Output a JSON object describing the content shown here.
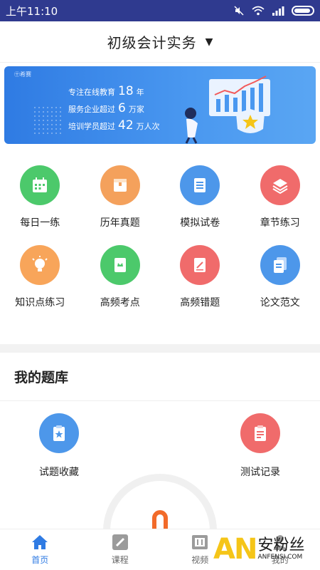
{
  "status": {
    "time": "上午11:10",
    "icons": [
      "mute-icon",
      "wifi-icon",
      "signal-icon",
      "battery-icon"
    ]
  },
  "header": {
    "title": "初级会计实务",
    "caret": "▼"
  },
  "banner": {
    "logo": "㊉希赛",
    "line1_pre": "专注在线教育",
    "line1_num": "18",
    "line1_post": "年",
    "line2_pre": "服务企业超过",
    "line2_num": "6",
    "line2_post": "万家",
    "line3_pre": "培训学员超过",
    "line3_num": "42",
    "line3_post": "万人次"
  },
  "grid": [
    {
      "label": "每日一练",
      "color": "#4cc96b",
      "icon": "calendar-icon"
    },
    {
      "label": "历年真题",
      "color": "#f4a15c",
      "icon": "box-icon"
    },
    {
      "label": "模拟试卷",
      "color": "#4d97ea",
      "icon": "scroll-icon"
    },
    {
      "label": "章节练习",
      "color": "#f06b6b",
      "icon": "layers-icon"
    },
    {
      "label": "知识点练习",
      "color": "#f8a55a",
      "icon": "bulb-icon"
    },
    {
      "label": "高频考点",
      "color": "#4cc96b",
      "icon": "book-icon"
    },
    {
      "label": "高频错题",
      "color": "#f06b6b",
      "icon": "notebook-icon"
    },
    {
      "label": "论文范文",
      "color": "#4d97ea",
      "icon": "documents-icon"
    }
  ],
  "library": {
    "title": "我的题库",
    "items": [
      {
        "label": "试题收藏",
        "color": "#4d97ea",
        "icon": "favorite-clipboard-icon"
      },
      {
        "label": "测试记录",
        "color": "#f06b6b",
        "icon": "record-clipboard-icon"
      }
    ]
  },
  "tabs": [
    {
      "label": "首页",
      "icon": "home-icon",
      "active": true
    },
    {
      "label": "课程",
      "icon": "pencil-icon",
      "active": false
    },
    {
      "label": "视频",
      "icon": "video-icon",
      "active": false
    },
    {
      "label": "我的",
      "icon": "user-icon",
      "active": false
    }
  ],
  "watermark": {
    "logo": "AN",
    "name": "安粉丝",
    "url": "ANFENSI.COM"
  },
  "colors": {
    "status_bar": "#2f3a8f",
    "accent": "#2f7be3"
  }
}
